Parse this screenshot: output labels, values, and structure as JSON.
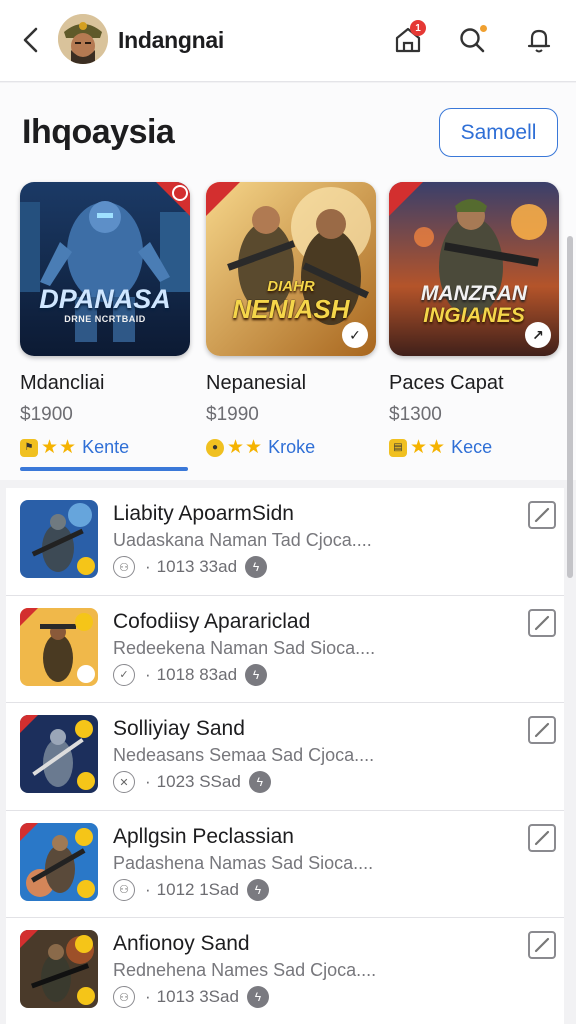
{
  "header": {
    "title": "Indangnai",
    "back_icon": "chevron-left-icon",
    "notification_count": "1",
    "icons": [
      "store-icon",
      "search-icon",
      "bell-icon"
    ]
  },
  "featured": {
    "section_title": "Ihqoaysia",
    "see_all_label": "Samoell",
    "cards": [
      {
        "name": "Mdancliai",
        "price": "$1900",
        "rating_label": "Kente",
        "art_title": "DPANASA",
        "art_sub": "DRNE NCRTBAID",
        "corner": "Z"
      },
      {
        "name": "Nepanesial",
        "price": "$1990",
        "rating_label": "Kroke",
        "art_title": "DIAHR",
        "art_sub": "NENIASH",
        "corner": "ZO"
      },
      {
        "name": "Paces Capat",
        "price": "$1300",
        "rating_label": "Kece",
        "art_title": "MANZRAN",
        "art_sub": "INGIANES",
        "corner": "169"
      }
    ]
  },
  "list": {
    "items": [
      {
        "title": "Liabity ApoarmSidn",
        "desc": "Uadaskana Naman Tad Cjoca....",
        "meta": "1013 33ad"
      },
      {
        "title": "Cofodiisy Aparariclad",
        "desc": "Redeekena Naman Sad Sioca....",
        "meta": "1018 83ad"
      },
      {
        "title": "Solliyiay Sand",
        "desc": "Nedeasans Semaa Sad Cjoca....",
        "meta": "1023 SSad"
      },
      {
        "title": "Apllgsin Peclassian",
        "desc": "Padashena Namas Sad Sioca....",
        "meta": "1012 1Sad"
      },
      {
        "title": "Anfionoy Sand",
        "desc": "Rednehena Names Sad Cjoca....",
        "meta": "1013 3Sad"
      }
    ]
  },
  "colors": {
    "accent": "#3a78d8",
    "badge_red": "#e53935",
    "star": "#f5b301"
  }
}
